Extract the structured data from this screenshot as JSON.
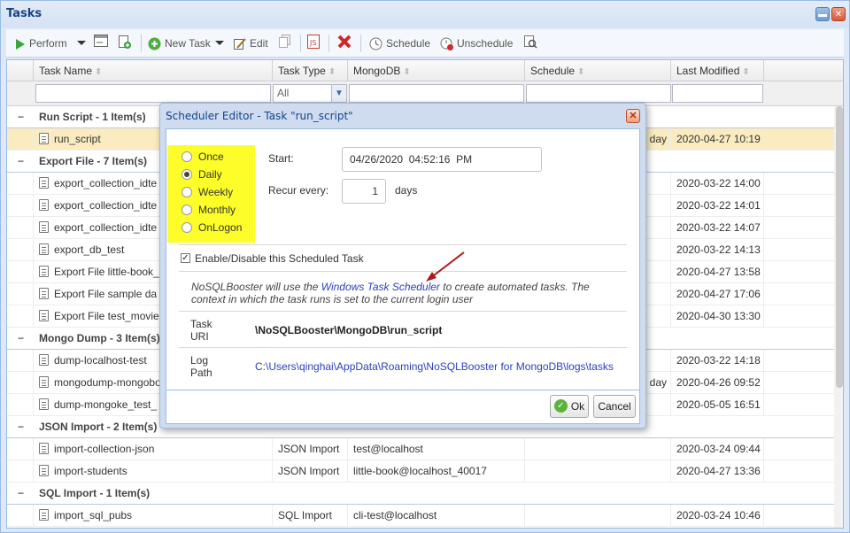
{
  "window": {
    "title": "Tasks"
  },
  "toolbar": {
    "perform": "Perform",
    "new_task": "New Task",
    "edit": "Edit",
    "schedule": "Schedule",
    "unschedule": "Unschedule"
  },
  "grid": {
    "columns": [
      "Task Name",
      "Task Type",
      "MongoDB",
      "Schedule",
      "Last Modified"
    ],
    "filter_type": "All",
    "groups": [
      {
        "title": "Run Script - 1 Item(s)",
        "rows": [
          {
            "name": "run_script",
            "type": "",
            "db": "",
            "schedule": "day",
            "modified": "2020-04-27 10:19",
            "selected": true
          }
        ]
      },
      {
        "title": "Export File - 7 Item(s)",
        "rows": [
          {
            "name": "export_collection_idte",
            "type": "",
            "db": "",
            "schedule": "",
            "modified": "2020-03-22 14:00"
          },
          {
            "name": "export_collection_idte",
            "type": "",
            "db": "",
            "schedule": "",
            "modified": "2020-03-22 14:01"
          },
          {
            "name": "export_collection_idte",
            "type": "",
            "db": "",
            "schedule": "",
            "modified": "2020-03-22 14:07"
          },
          {
            "name": "export_db_test",
            "type": "",
            "db": "",
            "schedule": "",
            "modified": "2020-03-22 14:13"
          },
          {
            "name": "Export File little-book_",
            "type": "",
            "db": "",
            "schedule": "",
            "modified": "2020-04-27 13:58"
          },
          {
            "name": "Export File sample da",
            "type": "",
            "db": "",
            "schedule": "",
            "modified": "2020-04-27 17:06"
          },
          {
            "name": "Export File test_movie",
            "type": "",
            "db": "",
            "schedule": "",
            "modified": "2020-04-30 13:30"
          }
        ]
      },
      {
        "title": "Mongo Dump - 3 Item(s)",
        "rows": [
          {
            "name": "dump-localhost-test",
            "type": "",
            "db": "",
            "schedule": "",
            "modified": "2020-03-22 14:18"
          },
          {
            "name": "mongodump-mongobo",
            "type": "",
            "db": "",
            "schedule": "1 day",
            "modified": "2020-04-26 09:52"
          },
          {
            "name": "dump-mongoke_test_",
            "type": "",
            "db": "",
            "schedule": "",
            "modified": "2020-05-05 16:51"
          }
        ]
      },
      {
        "title": "JSON Import - 2 Item(s)",
        "rows": [
          {
            "name": "import-collection-json",
            "type": "JSON Import",
            "db": "test@localhost",
            "schedule": "",
            "modified": "2020-03-24 09:44"
          },
          {
            "name": "import-students",
            "type": "JSON Import",
            "db": "little-book@localhost_40017",
            "schedule": "",
            "modified": "2020-04-27 13:36"
          }
        ]
      },
      {
        "title": "SQL Import - 1 Item(s)",
        "rows": [
          {
            "name": "import_sql_pubs",
            "type": "SQL Import",
            "db": "cli-test@localhost",
            "schedule": "",
            "modified": "2020-03-24 10:46"
          }
        ]
      }
    ]
  },
  "dialog": {
    "title": "Scheduler Editor - Task \"run_script\"",
    "options": [
      "Once",
      "Daily",
      "Weekly",
      "Monthly",
      "OnLogon"
    ],
    "selected_option": "Daily",
    "start_label": "Start:",
    "start_value": "04/26/2020  04:52:16  PM",
    "recur_label": "Recur every:",
    "recur_value": "1",
    "recur_unit": "days",
    "enable_label": "Enable/Disable this Scheduled Task",
    "enable_checked": true,
    "info_pre": "NoSQLBooster will use the ",
    "info_link": "Windows Task Scheduler",
    "info_post": " to create automated tasks. The context in which the task runs is set to the current login user",
    "task_uri_label": "Task URI",
    "task_uri_value": "\\NoSQLBooster\\MongoDB\\run_script",
    "log_path_label": "Log Path",
    "log_path_value": "C:\\Users\\qinghai\\AppData\\Roaming\\NoSQLBooster for MongoDB\\logs\\tasks",
    "ok_label": "Ok",
    "cancel_label": "Cancel"
  },
  "colors": {
    "highlight": "#fdfd2a",
    "selected_row": "#faecc0",
    "accent": "#15428b",
    "link": "#2a3fc0"
  }
}
